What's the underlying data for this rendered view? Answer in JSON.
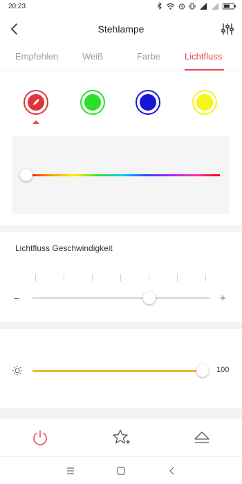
{
  "statusbar": {
    "time": "20:23"
  },
  "header": {
    "title": "Stehlampe"
  },
  "tabs": [
    {
      "label": "Empfehlen"
    },
    {
      "label": "Weiß"
    },
    {
      "label": "Farbe"
    },
    {
      "label": "Lichtfluss"
    }
  ],
  "active_tab": "Lichtfluss",
  "colors": {
    "accent": "#e0474c",
    "preset_red": "#e0343a",
    "preset_green": "#2ae02a",
    "preset_blue": "#1616d8",
    "preset_yellow": "#f5f518",
    "brightness_track": "#f0b92d"
  },
  "color_presets": [
    {
      "name": "red-edit",
      "icon": "pencil-icon",
      "selected": true
    },
    {
      "name": "green"
    },
    {
      "name": "blue"
    },
    {
      "name": "yellow"
    }
  ],
  "speed": {
    "label": "Lichtfluss Geschwindigkeit",
    "minus": "–",
    "plus": "+",
    "value_fraction": 0.66
  },
  "spectrum": {
    "value_fraction": 0.0
  },
  "brightness": {
    "icon": "sun-icon",
    "value": "100",
    "value_fraction": 1.0
  },
  "bottom_bar": {
    "icons": [
      "power-icon",
      "star-add-icon",
      "eject-icon"
    ]
  },
  "navbar": {
    "icons": [
      "menu-icon",
      "home-icon",
      "back-icon"
    ]
  }
}
